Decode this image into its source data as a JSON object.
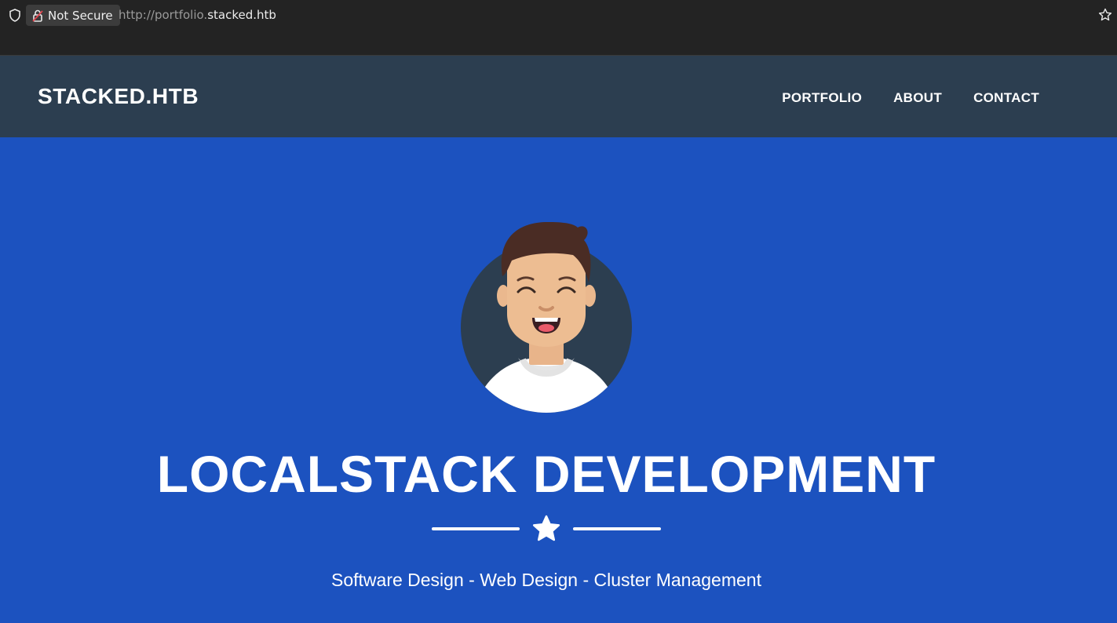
{
  "browser": {
    "security_label": "Not Secure",
    "url_scheme": "http://portfolio.",
    "url_host": "stacked.htb",
    "icons": [
      "shield-icon",
      "lock-icon",
      "star-icon"
    ]
  },
  "nav": {
    "brand": "STACKED.HTB",
    "links": [
      "PORTFOLIO",
      "ABOUT",
      "CONTACT"
    ],
    "background": "#2c3e50"
  },
  "hero": {
    "title": "LOCALSTACK DEVELOPMENT",
    "subtitle": "Software Design - Web Design - Cluster Management",
    "background": "#1c52bf",
    "divider_icon": "star-icon",
    "avatar_icon": "avatar-icon"
  }
}
